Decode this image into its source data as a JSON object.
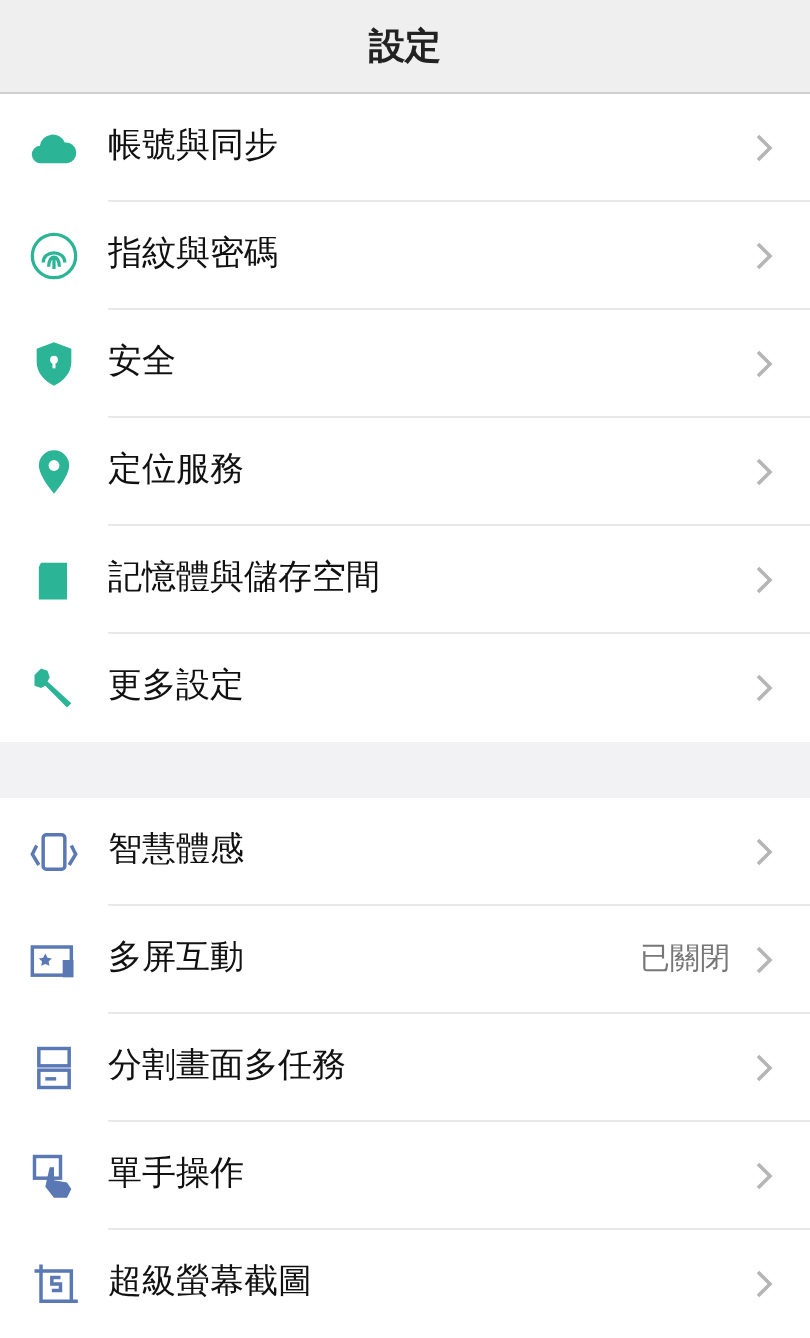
{
  "header": {
    "title": "設定"
  },
  "groups": [
    {
      "items": [
        {
          "kind": "cloud",
          "label": "帳號與同步"
        },
        {
          "kind": "fingerprint",
          "label": "指紋與密碼"
        },
        {
          "kind": "shield",
          "label": "安全"
        },
        {
          "kind": "pin",
          "label": "定位服務"
        },
        {
          "kind": "sdcard",
          "label": "記憶體與儲存空間"
        },
        {
          "kind": "wrench",
          "label": "更多設定"
        }
      ]
    },
    {
      "items": [
        {
          "kind": "phone",
          "label": "智慧體感"
        },
        {
          "kind": "screens",
          "label": "多屏互動",
          "status": "已關閉"
        },
        {
          "kind": "split",
          "label": "分割畫面多任務"
        },
        {
          "kind": "hand",
          "label": "單手操作"
        },
        {
          "kind": "screenshot",
          "label": "超級螢幕截圖"
        }
      ]
    }
  ]
}
